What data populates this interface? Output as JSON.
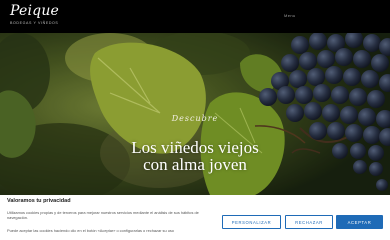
{
  "header": {
    "logo_text": "Peique",
    "logo_subtitle": "BODEGAS Y VIÑEDOS",
    "menu_label": "Menu"
  },
  "hero": {
    "script_title": "Descubre",
    "headline_line1": "Los viñedos viejos",
    "headline_line2": "con alma joven"
  },
  "cookie_banner": {
    "title": "Valoramos tu privacidad",
    "text": "Utilizamos cookies propias y de terceros para mejorar nuestros servicios mediante el análisis de sus hábitos de navegación.",
    "text2": "Puede aceptar las cookies haciendo clic en el botón «Aceptar» o configurarlas o rechazar su uso",
    "customize_label": "PERSONALIZAR",
    "reject_label": "RECHAZAR",
    "accept_label": "ACEPTAR"
  },
  "colors": {
    "accent": "#1f6bb7",
    "header_bg": "#000000"
  }
}
